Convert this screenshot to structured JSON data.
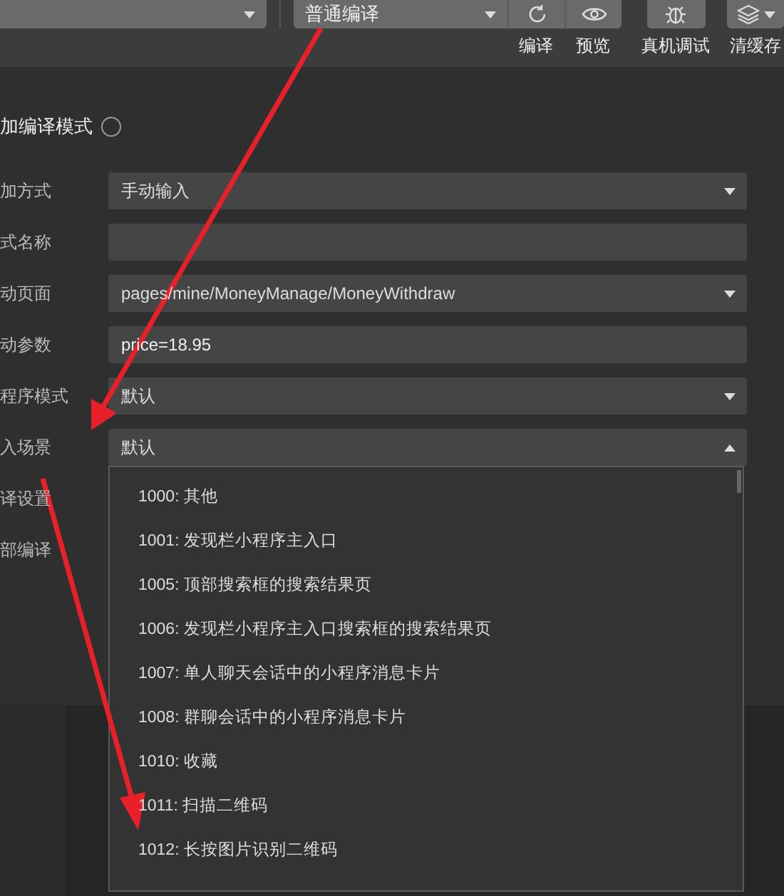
{
  "toolbar": {
    "compile_mode": {
      "value": "普通编译"
    },
    "tools": [
      {
        "kind": "refresh",
        "label": "编译"
      },
      {
        "kind": "preview",
        "label": "预览"
      },
      {
        "kind": "debug",
        "label": "真机调试"
      },
      {
        "kind": "cache",
        "label": "清缓存"
      }
    ]
  },
  "form": {
    "title": "加编译模式",
    "fields": [
      {
        "label": "加方式",
        "kind": "select",
        "value": "手动输入",
        "expanded": false
      },
      {
        "label": "式名称",
        "kind": "text"
      },
      {
        "label": "动页面",
        "kind": "select",
        "value": "pages/mine/MoneyManage/MoneyWithdraw",
        "expanded": false
      },
      {
        "label": "动参数",
        "kind": "text",
        "value": "price=18.95"
      },
      {
        "label": "程序模式",
        "kind": "select",
        "value": "默认",
        "expanded": false
      },
      {
        "label": "入场景",
        "kind": "select",
        "value": "默认",
        "expanded": true
      },
      {
        "label": "译设置",
        "kind": "label"
      },
      {
        "label": "部编译",
        "kind": "label"
      }
    ]
  },
  "scene_options": [
    {
      "label": "1000: 其他",
      "selected": false
    },
    {
      "label": "1001: 发现栏小程序主入口",
      "selected": false
    },
    {
      "label": "1005: 顶部搜索框的搜索结果页",
      "selected": false
    },
    {
      "label": "1006: 发现栏小程序主入口搜索框的搜索结果页",
      "selected": false
    },
    {
      "label": "1007: 单人聊天会话中的小程序消息卡片",
      "selected": false
    },
    {
      "label": "1008: 群聊会话中的小程序消息卡片",
      "selected": false
    },
    {
      "label": "1010: 收藏",
      "selected": false
    },
    {
      "label": "1011: 扫描二维码",
      "selected": false
    },
    {
      "label": "1012: 长按图片识别二维码",
      "selected": false
    }
  ]
}
